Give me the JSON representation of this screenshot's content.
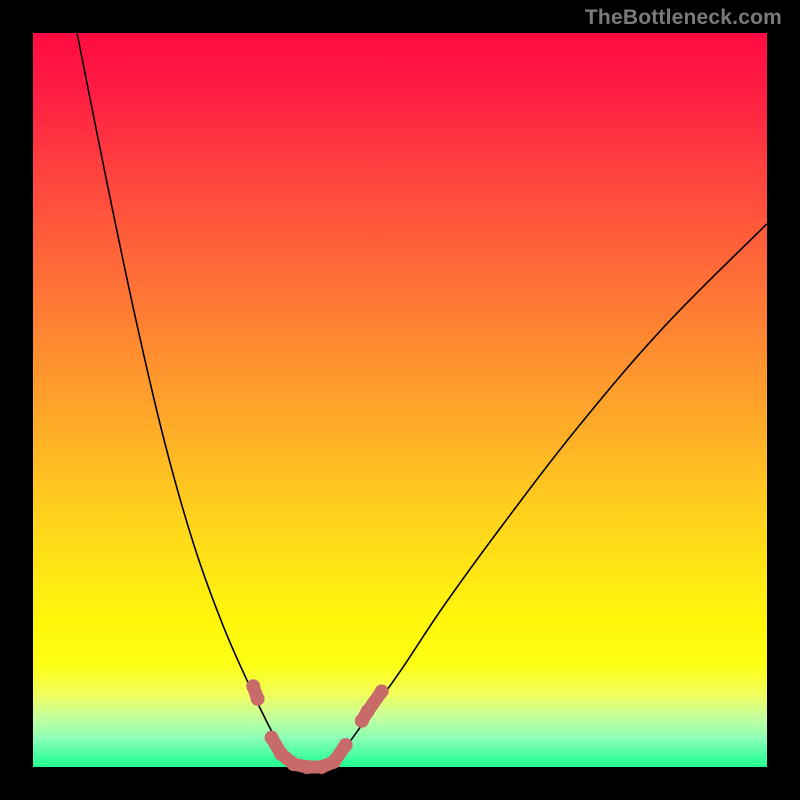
{
  "attribution": "TheBottleneck.com",
  "colors": {
    "dot": "#c96a6a",
    "curve": "#000000"
  },
  "chart_data": {
    "type": "line",
    "title": "",
    "xlabel": "",
    "ylabel": "",
    "xlim": [
      0,
      100
    ],
    "ylim": [
      0,
      100
    ],
    "series": [
      {
        "name": "left-curve",
        "x": [
          6,
          10,
          14,
          18,
          22,
          26,
          30,
          33,
          35.7
        ],
        "y": [
          100,
          80,
          61,
          44,
          30,
          19,
          10,
          4,
          0
        ]
      },
      {
        "name": "right-curve",
        "x": [
          40.7,
          45,
          50,
          56,
          64,
          74,
          86,
          100
        ],
        "y": [
          0,
          6,
          13,
          22,
          33,
          46,
          60,
          74
        ]
      }
    ],
    "markers": [
      {
        "x": 30.0,
        "y": 11.0
      },
      {
        "x": 30.6,
        "y": 9.3
      },
      {
        "x": 32.5,
        "y": 4.0
      },
      {
        "x": 33.8,
        "y": 1.8
      },
      {
        "x": 35.5,
        "y": 0.4
      },
      {
        "x": 37.3,
        "y": 0.0
      },
      {
        "x": 39.3,
        "y": 0.0
      },
      {
        "x": 41.0,
        "y": 0.7
      },
      {
        "x": 42.6,
        "y": 3.0
      },
      {
        "x": 44.8,
        "y": 6.3
      },
      {
        "x": 45.6,
        "y": 7.6
      },
      {
        "x": 47.5,
        "y": 10.3
      }
    ]
  }
}
